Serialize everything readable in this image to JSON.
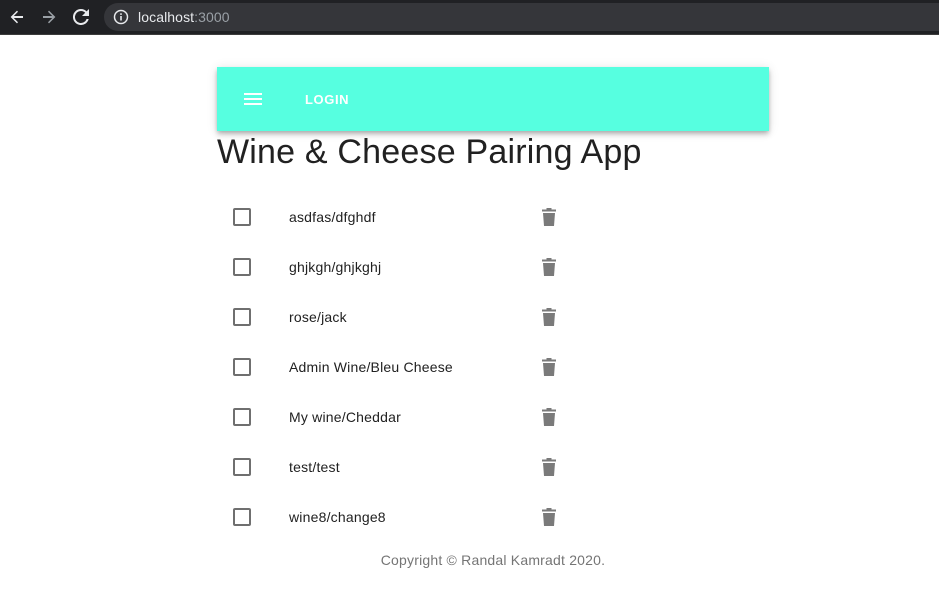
{
  "browser": {
    "url_host": "localhost",
    "url_port": ":3000",
    "icons": {
      "back": "arrow-left-icon",
      "forward": "arrow-right-icon",
      "reload": "reload-icon",
      "info": "info-icon"
    }
  },
  "appbar": {
    "menu_icon": "hamburger-menu-icon",
    "login_label": "LOGIN",
    "color": "#56ffe0"
  },
  "page": {
    "title": "Wine & Cheese Pairing App"
  },
  "pairings": [
    {
      "label": "asdfas/dfghdf",
      "checked": false
    },
    {
      "label": "ghjkgh/ghjkghj",
      "checked": false
    },
    {
      "label": "rose/jack",
      "checked": false
    },
    {
      "label": "Admin Wine/Bleu Cheese",
      "checked": false
    },
    {
      "label": "My wine/Cheddar",
      "checked": false
    },
    {
      "label": "test/test",
      "checked": false
    },
    {
      "label": "wine8/change8",
      "checked": false
    }
  ],
  "footer": {
    "copyright": "Copyright © Randal Kamradt 2020."
  }
}
